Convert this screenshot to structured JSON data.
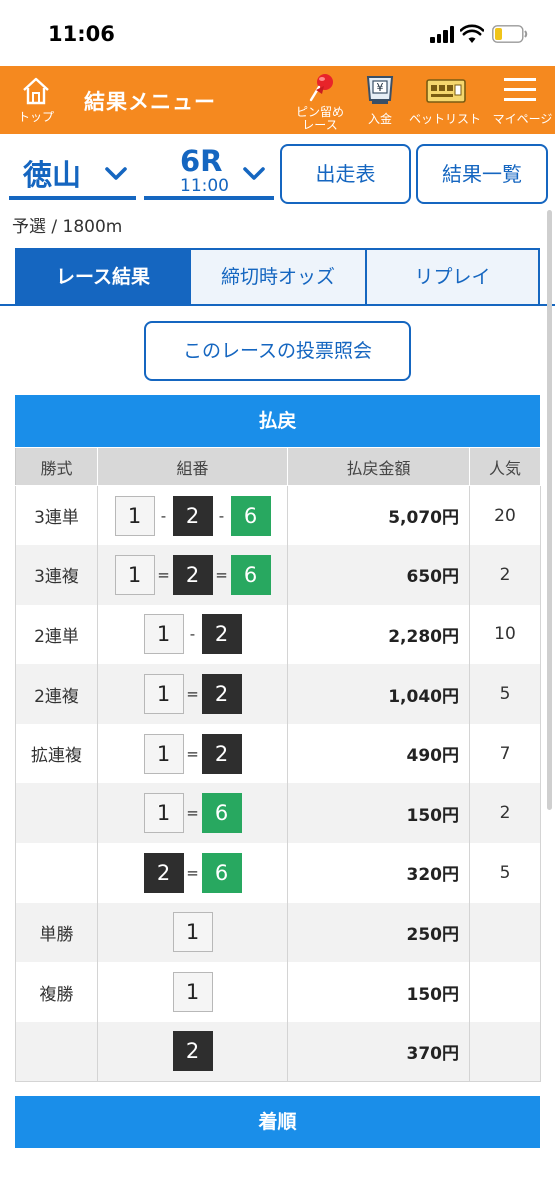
{
  "status_bar": {
    "time": "11:06"
  },
  "header": {
    "home_label": "トップ",
    "title": "結果メニュー",
    "pin_label_line1": "ピン留め",
    "pin_label_line2": "レース",
    "deposit_label": "入金",
    "deposit_icon_glyph": "¥",
    "betlist_label": "ベットリスト",
    "mypage_label": "マイページ",
    "color": "#f5891f"
  },
  "selectors": {
    "venue": "徳山",
    "race": "6R",
    "race_time": "11:00",
    "entry_table_button": "出走表",
    "results_list_button": "結果一覧"
  },
  "race_info": "予選 / 1800m",
  "tabs": [
    {
      "label": "レース結果",
      "active": true
    },
    {
      "label": "締切時オッズ",
      "active": false
    },
    {
      "label": "リプレイ",
      "active": false
    }
  ],
  "vote_query_button": "このレースの投票照会",
  "payout": {
    "title": "払戻",
    "columns": [
      "勝式",
      "組番",
      "払戻金額",
      "人気"
    ],
    "rows": [
      {
        "type": "3連単",
        "boats": [
          "1",
          "2",
          "6"
        ],
        "seps": [
          "-",
          "-"
        ],
        "amount": "5,070円",
        "popularity": "20"
      },
      {
        "type": "3連複",
        "boats": [
          "1",
          "2",
          "6"
        ],
        "seps": [
          "=",
          "="
        ],
        "amount": "650円",
        "popularity": "2"
      },
      {
        "type": "2連単",
        "boats": [
          "1",
          "2"
        ],
        "seps": [
          "-"
        ],
        "amount": "2,280円",
        "popularity": "10"
      },
      {
        "type": "2連複",
        "boats": [
          "1",
          "2"
        ],
        "seps": [
          "="
        ],
        "amount": "1,040円",
        "popularity": "5"
      },
      {
        "type": "拡連複",
        "boats": [
          "1",
          "2"
        ],
        "seps": [
          "="
        ],
        "amount": "490円",
        "popularity": "7"
      },
      {
        "type": "",
        "boats": [
          "1",
          "6"
        ],
        "seps": [
          "="
        ],
        "amount": "150円",
        "popularity": "2"
      },
      {
        "type": "",
        "boats": [
          "2",
          "6"
        ],
        "seps": [
          "="
        ],
        "amount": "320円",
        "popularity": "5"
      },
      {
        "type": "単勝",
        "boats": [
          "1"
        ],
        "seps": [],
        "amount": "250円",
        "popularity": ""
      },
      {
        "type": "複勝",
        "boats": [
          "1"
        ],
        "seps": [],
        "amount": "150円",
        "popularity": ""
      },
      {
        "type": "",
        "boats": [
          "2"
        ],
        "seps": [],
        "amount": "370円",
        "popularity": ""
      }
    ]
  },
  "order_title": "着順",
  "colors": {
    "primary_blue": "#1566c0",
    "table_head_blue": "#1a8ee9",
    "boat_1": "#f5f5f5",
    "boat_2": "#2e2e2e",
    "boat_6": "#28a860"
  }
}
